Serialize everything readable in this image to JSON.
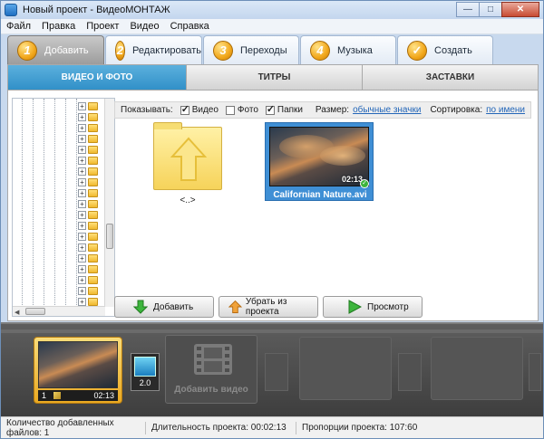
{
  "window": {
    "title": "Новый проект - ВидеоМОНТАЖ",
    "controls": {
      "minimize": "—",
      "maximize": "□",
      "close": "✕"
    }
  },
  "menu": [
    "Файл",
    "Правка",
    "Проект",
    "Видео",
    "Справка"
  ],
  "steps": [
    {
      "num": "1",
      "label": "Добавить",
      "active": true
    },
    {
      "num": "2",
      "label": "Редактировать",
      "active": false
    },
    {
      "num": "3",
      "label": "Переходы",
      "active": false
    },
    {
      "num": "4",
      "label": "Музыка",
      "active": false
    },
    {
      "num": "✓",
      "label": "Создать",
      "active": false
    }
  ],
  "subtabs": [
    "ВИДЕО И ФОТО",
    "ТИТРЫ",
    "ЗАСТАВКИ"
  ],
  "filter": {
    "show_label": "Показывать:",
    "checks": [
      {
        "label": "Видео",
        "checked": true
      },
      {
        "label": "Фото",
        "checked": false
      },
      {
        "label": "Папки",
        "checked": true
      }
    ],
    "size_label": "Размер:",
    "size_value": "обычные значки",
    "sort_label": "Сортировка:",
    "sort_value": "по имени"
  },
  "files": {
    "up_label": "<..>",
    "video": {
      "name": "Californian Nature.avi",
      "duration": "02:13"
    }
  },
  "actions": {
    "add": "Добавить",
    "remove": "Убрать из проекта",
    "preview": "Просмотр"
  },
  "timeline": {
    "clip": {
      "index": "1",
      "duration": "02:13"
    },
    "transition": {
      "duration": "2.0"
    },
    "add_video": "Добавить видео"
  },
  "status": {
    "files_count": "Количество добавленных файлов: 1",
    "duration": "Длительность проекта: 00:02:13",
    "proportions": "Пропорции проекта: 107:60"
  },
  "colors": {
    "accent_tab": "#3190c8",
    "step_badge": "#f2a81c",
    "video_tile": "#3f8fd5"
  }
}
